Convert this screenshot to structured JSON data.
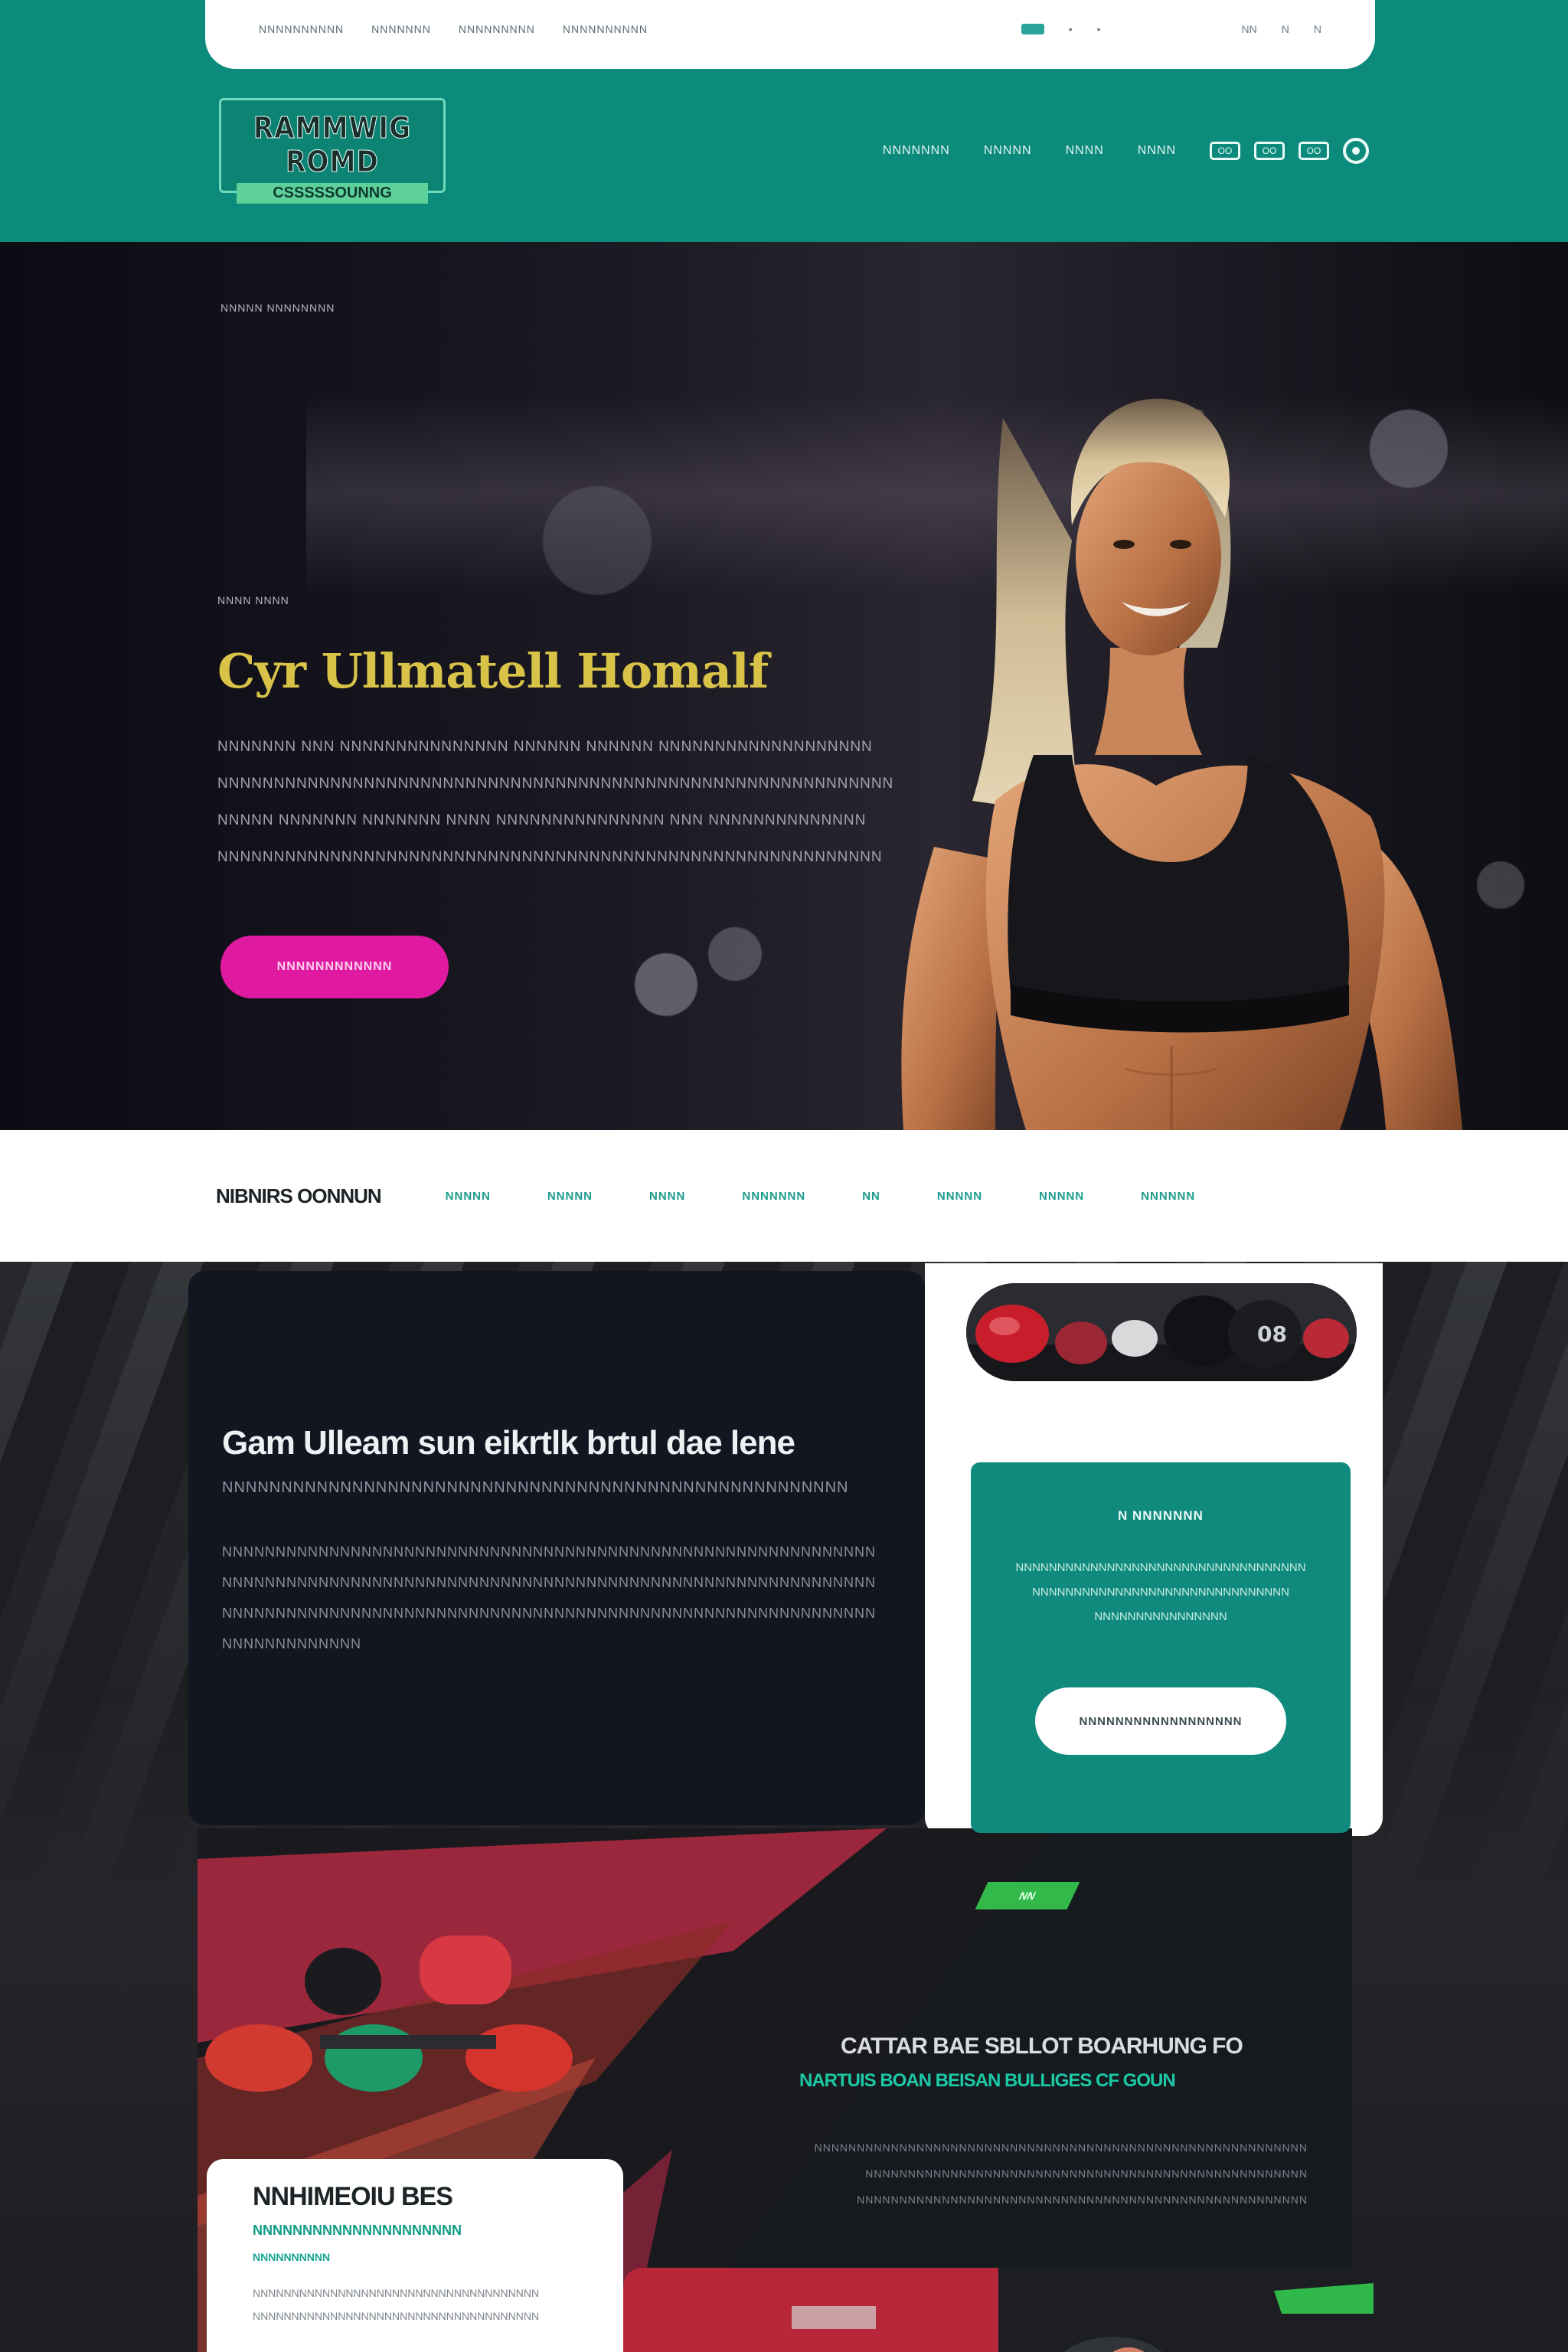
{
  "top_bar": {
    "links": [
      "NNNNNNNNNN",
      "NNNNNNN",
      "NNNNNNNNN",
      "NNNNNNNNNN"
    ],
    "right_links": [
      "•",
      "•",
      "NN",
      "N",
      "N"
    ]
  },
  "header": {
    "logo_title": "RAMMWIG ROMD",
    "logo_subtitle": "CSSSSSOUNNG",
    "nav_links": [
      "NNNNNNN",
      "NNNNN",
      "NNNN",
      "NNNN"
    ],
    "nav_icons": [
      "OO",
      "OO",
      "OO"
    ]
  },
  "hero": {
    "kicker": "NNNNN NNNNNNNN",
    "tag": "NNNN NNNN",
    "title": "Cyr Ullmatell Homalf",
    "body_lines": [
      "NNNNNNN NNN NNNNNNNNNNNNNNN NNNNNN NNNNNN NNNNNNNNNNNNNNNNNNN",
      "NNNNNNNNNNNNNNNNNNNNNNNNNNNNNNNNNNNNNNNNNNNNNNNNNNNNNNNNNNNN",
      "NNNNN NNNNNNN NNNNNNN NNNN NNNNNNNNNNNNNNN NNN NNNNNNNNNNNNNN",
      "NNNNNNNNNNNNNNNNNNNNNNNNNNNNNNNNNNNNNNNNNNNNNNNNNNNNNNNNNNN"
    ],
    "cta": "NNNNNNNNNNNN"
  },
  "subnav": {
    "brand": "NIBNIRS OONNUN",
    "links": [
      "NNNNN",
      "NNNNN",
      "NNNN",
      "NNNNNNN",
      "NN",
      "NNNNN",
      "NNNNN",
      "NNNNNN"
    ]
  },
  "feature": {
    "title": "Gam Ulleam sun eikrtlk brtul dae lene",
    "subtitle": "NNNNNNNNNNNNNNNNNNNNNNNNNNNNNNNNNNNNNNNNNNNNNNNNNNNNN",
    "body_lines": [
      "NNNNNNNNNNNNNNNNNNNNNNNNNNNNNNNNNNNNNNNNNNNNNNNNNNNNNNNNNNNNN",
      "NNNNNNNNNNNNNNNNNNNNNNNNNNNNNNNNNNNNNNNNNNNNNNNNNNNNNNNNNNNNN",
      "NNNNNNNNNNNNNNNNNNNNNNNNNNNNNNNNNNNNNNNNNNNNNNNNNNNNNNNNNNNNN",
      "NNNNNNNNNNNNN"
    ]
  },
  "cta_card": {
    "title": "N NNNNNNN",
    "body_lines": [
      "NNNNNNNNNNNNNNNNNNNNNNNNNNNNNNNNNNN",
      "NNNNNNNNNNNNNNNNNNNNNNNNNNNNNNN",
      "NNNNNNNNNNNNNNNN"
    ],
    "button": "NNNNNNNNNNNNNNNNNN"
  },
  "promo": {
    "badge": "NN",
    "title": "CATTAR BAE SBLLOT BOARHUNG FO",
    "subtitle": "NARTUIS BOAN BEISAN BULLIGES CF GOUN",
    "body_lines": [
      "NNNNNNNNNNNNNNNNNNNNNNNNNNNNNNNNNNNNNNNNNNNNNNNNNNNNNNNNNN",
      "NNNNNNNNNNNNNNNNNNNNNNNNNNNNNNNNNNNNNNNNNNNNNNNNNNNN",
      "NNNNNNNNNNNNNNNNNNNNNNNNNNNNNNNNNNNNNNNNNNNNNNNNNNNNN"
    ]
  },
  "info_card": {
    "title": "NNHIMEOIU BES",
    "subtitle": "NNNNNNNNNNNNNNNNNNNNN",
    "subtitle2": "NNNNNNNNNN",
    "body_lines": [
      "NNNNNNNNNNNNNNNNNNNNNNNNNNNNNNNNNNNNN",
      "NNNNNNNNNNNNNNNNNNNNNNNNNNNNNNNNNNNNN"
    ]
  },
  "colors": {
    "teal": "#0c8a7b",
    "magenta": "#e01aa0",
    "gold": "#d8c348",
    "green_accent": "#1cc9a6"
  }
}
